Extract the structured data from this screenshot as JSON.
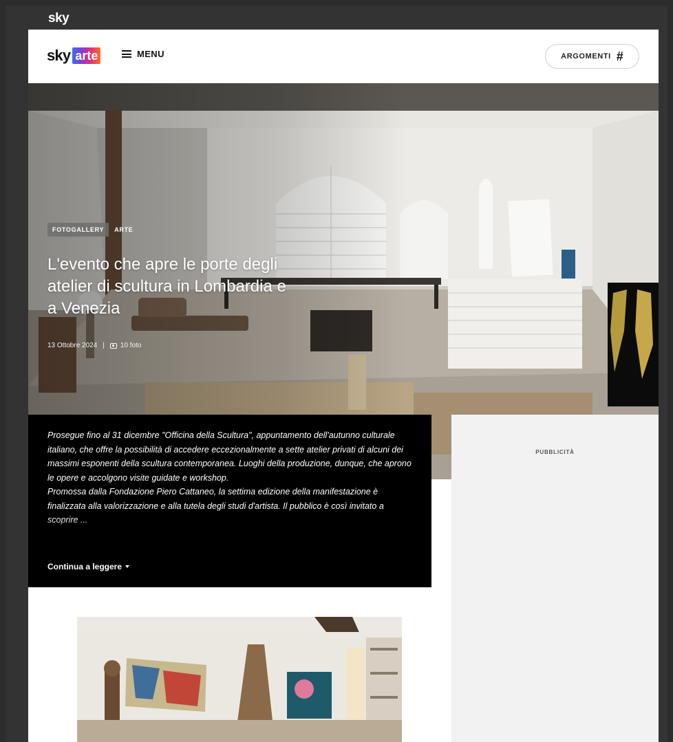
{
  "top_bar": {
    "logo": "sky"
  },
  "header": {
    "brand_sky": "sky",
    "brand_arte": "arte",
    "menu_label": "MENU",
    "argomenti_label": "ARGOMENTI",
    "argomenti_icon": "#"
  },
  "article": {
    "tags": [
      "FOTOGALLERY",
      "ARTE"
    ],
    "title": "L'evento che apre le porte degli atelier di scultura in Lombardia e a Venezia",
    "date": "13 Ottobre 2024",
    "separator": "|",
    "photo_count": "10 foto",
    "summary_p1": "Prosegue fino al 31 dicembre \"Officina della Scultura\", appuntamento dell'autunno culturale italiano, che offre la possibilità di accedere eccezionalmente a sette atelier privati di alcuni dei massimi esponenti della scultura contemporanea. Luoghi della produzione, dunque, che aprono le opere e accolgono visite guidate e workshop.",
    "summary_p2": "Promossa dalla Fondazione Piero Cattaneo, la settima edizione della manifestazione è finalizzata alla valorizzazione e alla tutela degli studi d'artista. Il pubblico è così invitato a scoprire ...",
    "continue_label": "Continua a leggere"
  },
  "ad": {
    "label": "PUBBLICITÀ"
  },
  "icons": {
    "menu": "hamburger-icon",
    "topics": "hash-icon",
    "photos": "camera-icon",
    "expand": "caret-down-icon"
  },
  "colors": {
    "page_bg": "#333333",
    "summary_bg": "#000000",
    "ad_bg": "#f2f2f2"
  }
}
